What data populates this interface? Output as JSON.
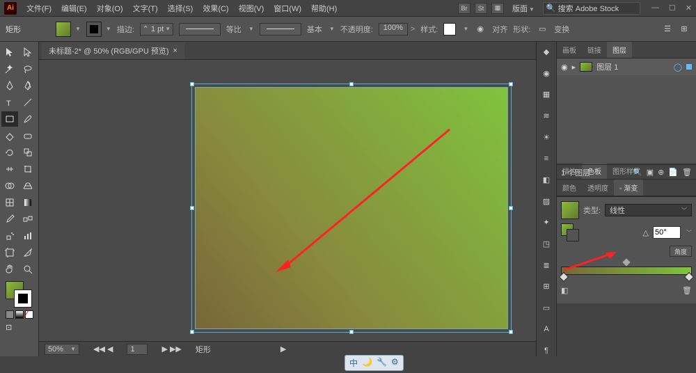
{
  "app": {
    "logo": "Ai"
  },
  "menu": {
    "file": "文件(F)",
    "edit": "编辑(E)",
    "object": "对象(O)",
    "type": "文字(T)",
    "select": "选择(S)",
    "effect": "效果(C)",
    "view": "视图(V)",
    "window": "窗口(W)",
    "help": "帮助(H)"
  },
  "title_btns": {
    "br": "Br",
    "st": "St"
  },
  "workspace_label": "版面",
  "search_placeholder": "搜索 Adobe Stock",
  "ctrl": {
    "tool_name": "矩形",
    "stroke_label": "描边:",
    "stroke_width": "1 pt",
    "stroke_profile": "等比",
    "brush_style": "基本",
    "opacity_label": "不透明度:",
    "opacity_value": "100%",
    "style_label": "样式:",
    "align_label": "对齐",
    "shape_label": "形状:",
    "transform_label": "变换"
  },
  "doc": {
    "tab_title": "未标题-2* @ 50% (RGB/GPU 预览)",
    "close": "×"
  },
  "status": {
    "zoom": "50%",
    "nav1": "1",
    "info": "矩形"
  },
  "panels": {
    "layers_tabs": {
      "artboards": "画板",
      "links": "链接",
      "layers": "图层"
    },
    "layer1": "图层 1",
    "layer_count": "1 个图层",
    "tabs2": {
      "stroke": "描边",
      "swatches": "色板",
      "graphic_styles": "图形样式"
    },
    "tabs3": {
      "color": "颜色",
      "transparency": "透明度",
      "gradient": "◦ 渐变"
    },
    "gradient": {
      "type_label": "类型:",
      "type_value": "线性",
      "angle_value": "50°",
      "angle_btn": "角度"
    }
  },
  "icons": {
    "search": "🔍",
    "minimize": "—",
    "maximize": "☐",
    "close": "✕",
    "eye": "👁",
    "gear": "⚙",
    "trash": "🗑",
    "new": "📄",
    "ime_zh": "中",
    "ime_moon": "🌙",
    "ime_tool": "🔧",
    "ime_gear": "⚙"
  }
}
